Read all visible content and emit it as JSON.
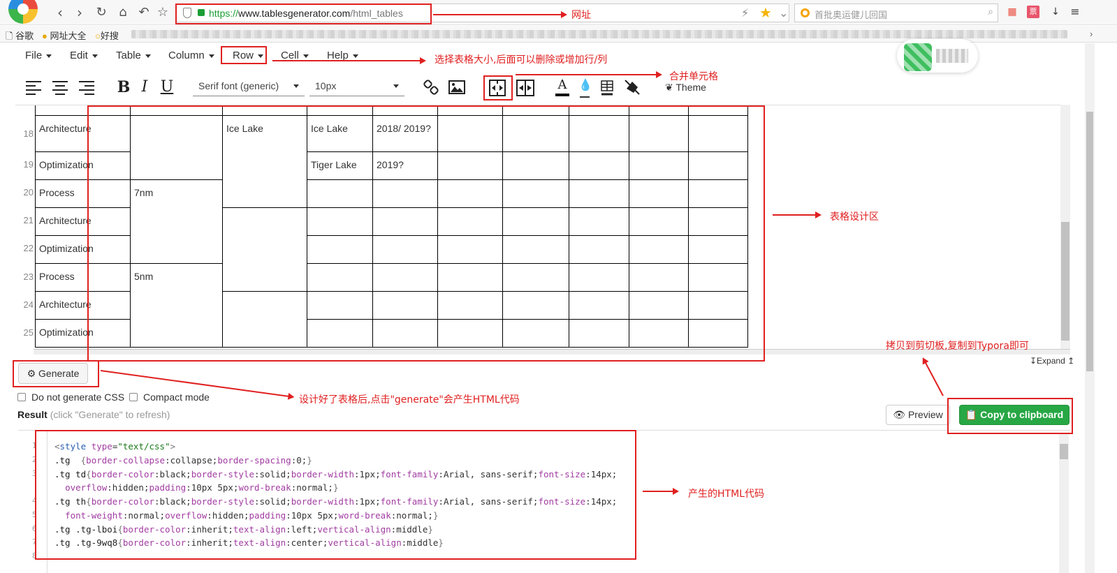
{
  "browser": {
    "url_scheme": "https://",
    "url_host": "www.tablesgenerator.com",
    "url_path": "/html_tables",
    "search_placeholder": "首批奥运健儿回国"
  },
  "bookmarks": [
    {
      "label": "谷歌"
    },
    {
      "label": "网址大全"
    },
    {
      "label": "好搜"
    }
  ],
  "menu": [
    "File",
    "Edit",
    "Table",
    "Column",
    "Row",
    "Cell",
    "Help"
  ],
  "toolbar": {
    "font_family": "Serif font (generic)",
    "font_size": "10px",
    "theme_label": "Theme"
  },
  "designer": {
    "row_numbers": [
      "18",
      "19",
      "20",
      "21",
      "22",
      "23",
      "24",
      "25"
    ],
    "cells": {
      "r18c0": "Architecture",
      "r18c2": "Ice Lake",
      "r18c3": "Ice Lake",
      "r18c4": "2018/ 2019?",
      "r19c0": "Optimization",
      "r19c3": "Tiger Lake",
      "r19c4": "2019?",
      "r20c0": "Process",
      "r20c1": "7nm",
      "r21c0": "Architecture",
      "r22c0": "Optimization",
      "r23c0": "Process",
      "r23c1": "5nm",
      "r24c0": "Architecture",
      "r25c0": "Optimization"
    },
    "expand_label": "↧Expand ↥"
  },
  "generate": {
    "button_label": "Generate",
    "option_no_css": "Do not generate CSS",
    "option_compact": "Compact mode",
    "result_label": "Result",
    "result_hint": "(click \"Generate\" to refresh)",
    "preview_label": "Preview",
    "copy_label": "Copy to clipboard"
  },
  "code_lines": [
    "1",
    "2",
    "3",
    "4",
    "5",
    "6",
    "7",
    "8"
  ],
  "annotations": {
    "url": "网址",
    "row_menu": "选择表格大小,后面可以删除或增加行/列",
    "merge": "合并单元格",
    "design_area": "表格设计区",
    "generate_hint": "设计好了表格后,点击\"generate\"会产生HTML代码",
    "copy_hint": "拷贝到剪切板,复制到Typora即可",
    "html_code": "产生的HTML代码"
  },
  "colors": {
    "annotation": "#e02020",
    "copy_button": "#28a745",
    "url_green": "#1a9e34"
  }
}
